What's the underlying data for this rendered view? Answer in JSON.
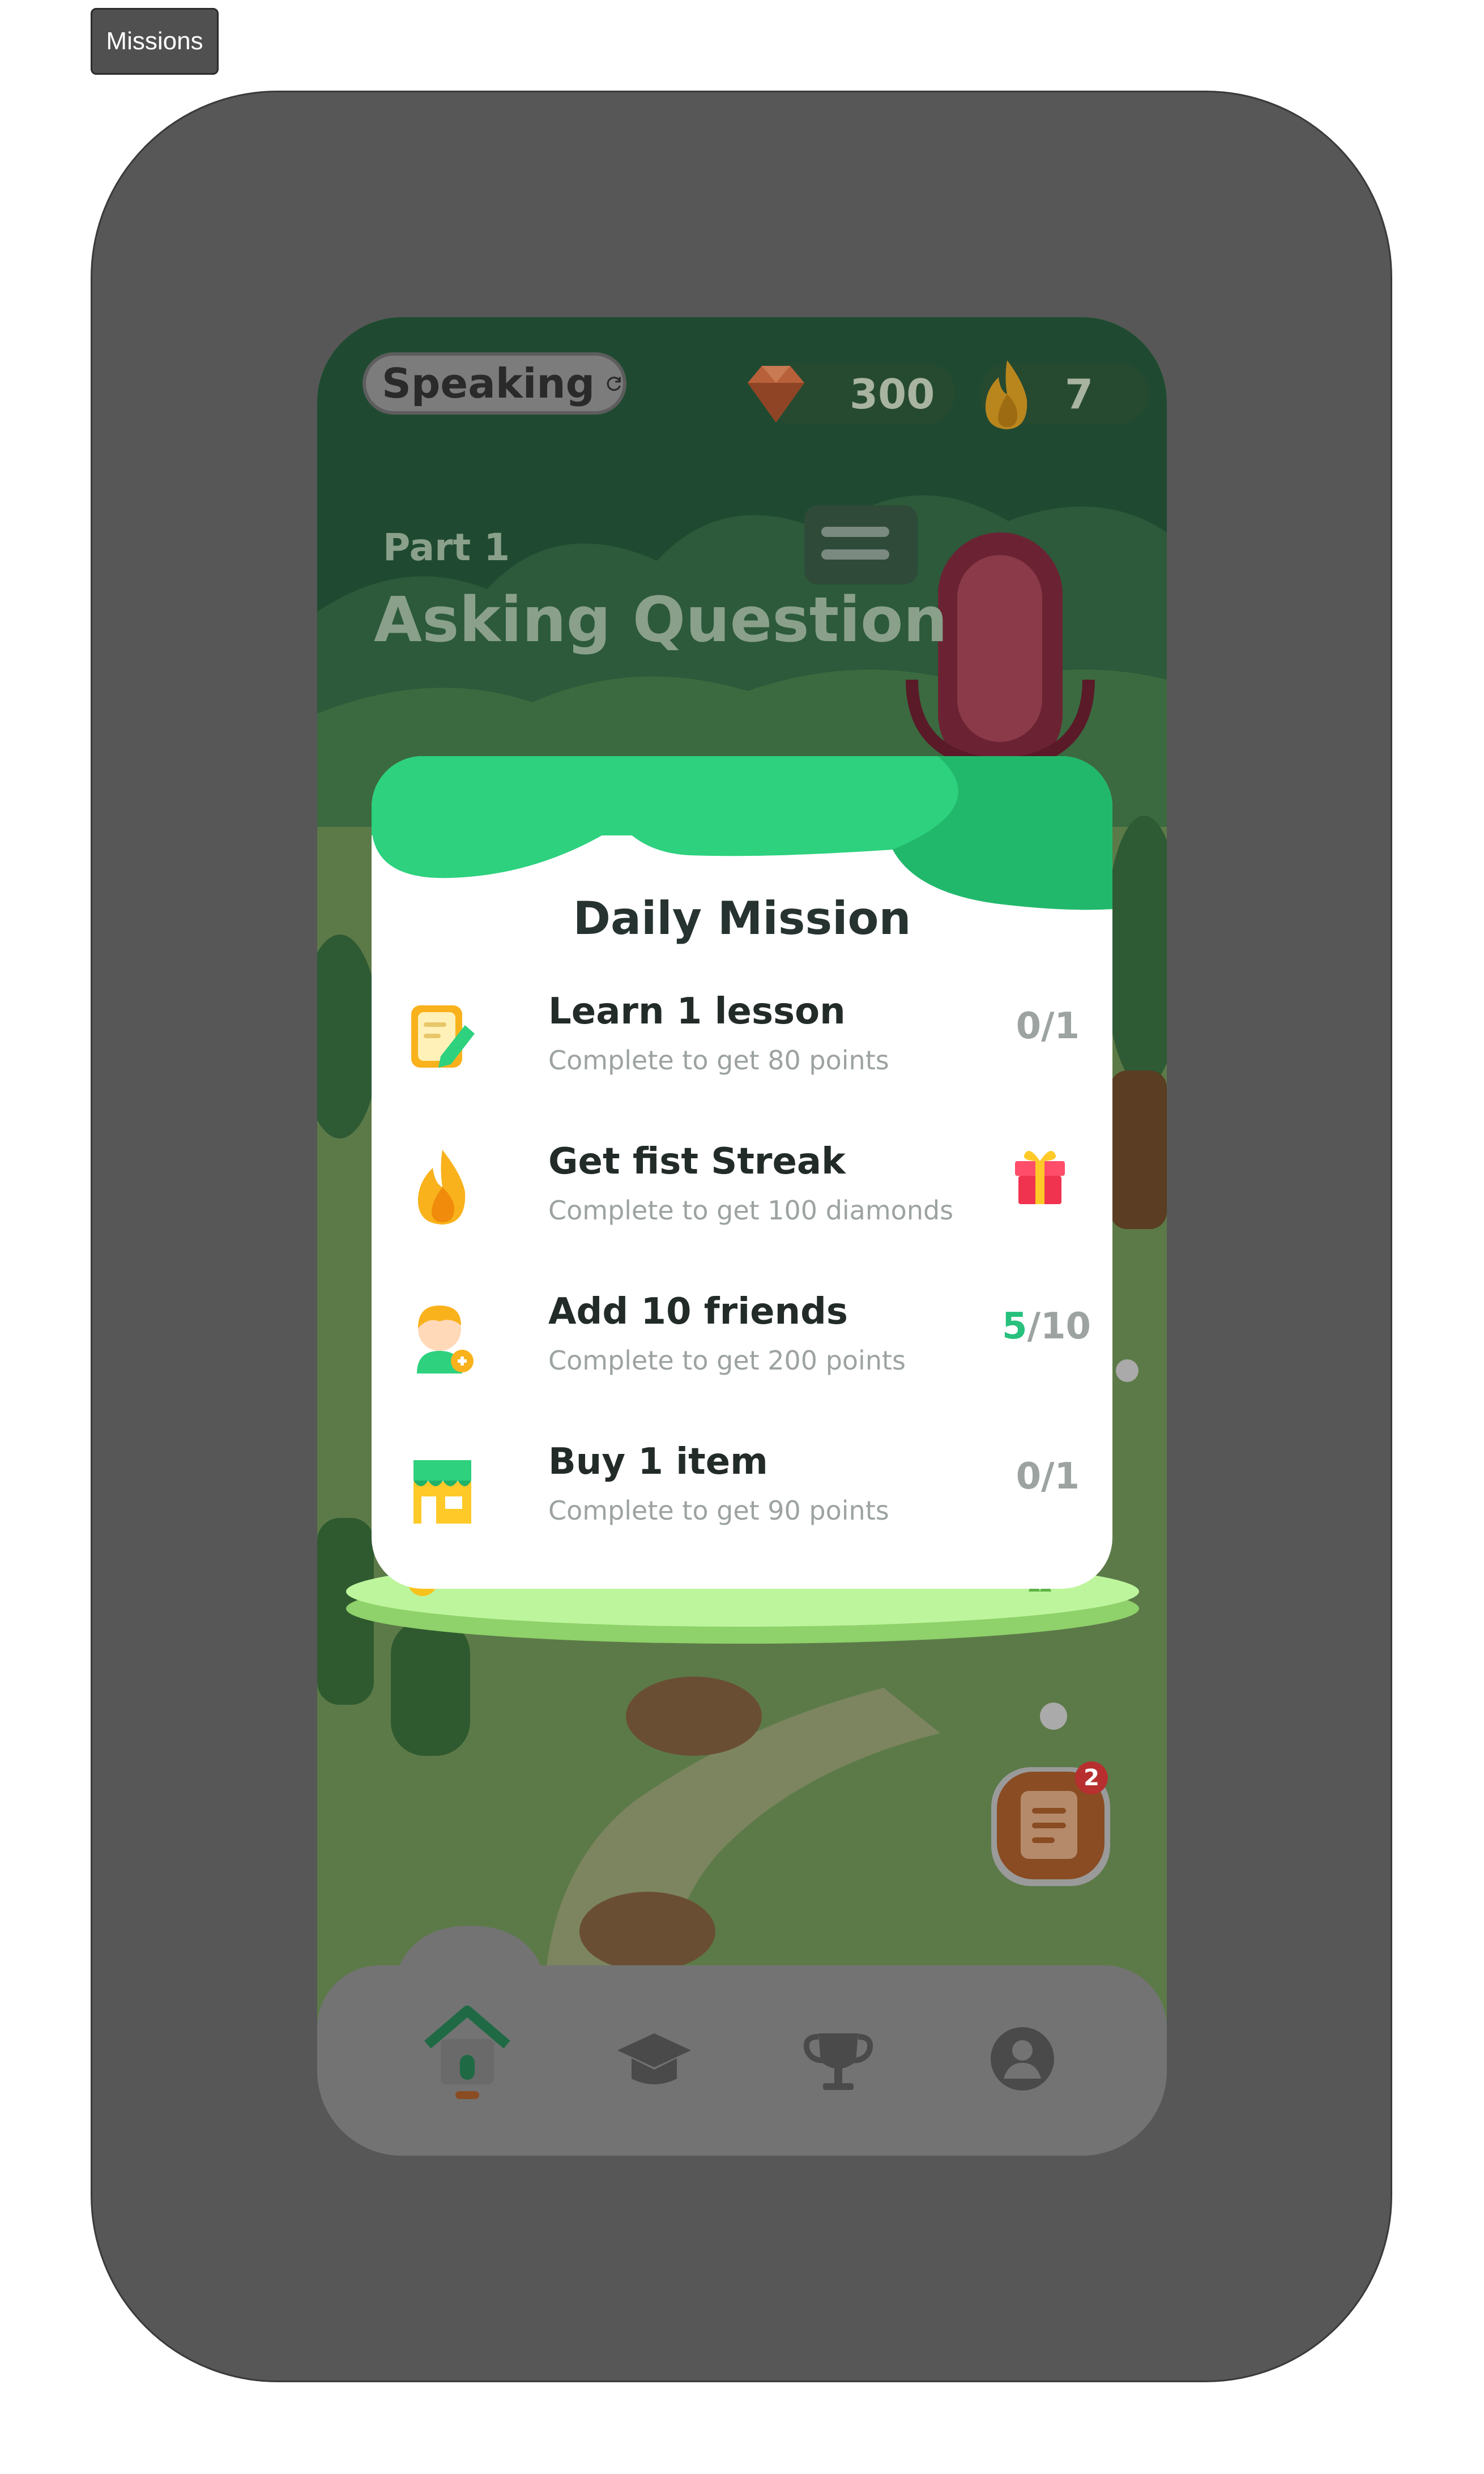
{
  "tag": {
    "label": "Missions"
  },
  "header": {
    "mode_label": "Speaking",
    "diamonds": "300",
    "streak": "7"
  },
  "lesson": {
    "part": "Part 1",
    "title": "Asking Question"
  },
  "daily_mission": {
    "title": "Daily Mission",
    "items": [
      {
        "title": "Learn 1 lesson",
        "subtitle": "Complete to get 80 points",
        "progress": "0/1",
        "icon": "pencil-note-icon"
      },
      {
        "title": "Get fist Streak",
        "subtitle": "Complete to get 100 diamonds",
        "reward_icon": "gift-icon",
        "icon": "flame-icon"
      },
      {
        "title": "Add 10 friends",
        "subtitle": "Complete to get 200 points",
        "progress_done": "5",
        "progress_total": "/10",
        "icon": "add-friend-icon"
      },
      {
        "title": "Buy 1 item",
        "subtitle": "Complete to get 90 points",
        "progress": "0/1",
        "icon": "shop-icon"
      }
    ]
  },
  "missions_button": {
    "badge": "2"
  },
  "nav": {
    "items": [
      "home-icon",
      "graduation-cap-icon",
      "trophy-icon",
      "profile-icon"
    ]
  },
  "colors": {
    "accent_green": "#27c07d",
    "card_top_green": "#2dd17e",
    "overlay_gray": "#575757"
  }
}
